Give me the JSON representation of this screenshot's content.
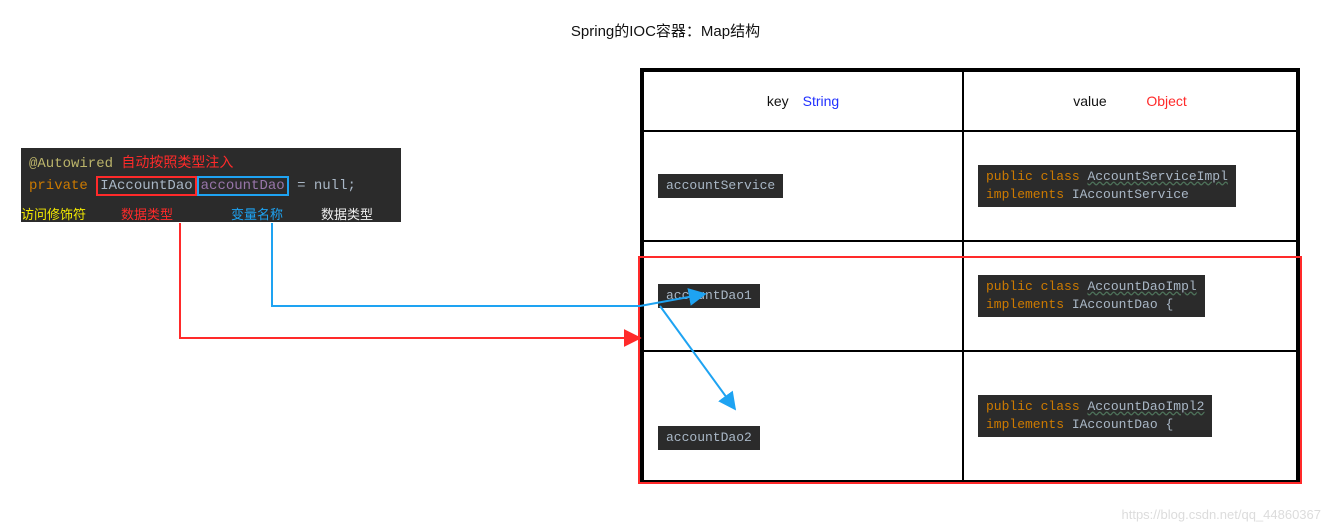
{
  "title": "Spring的IOC容器：Map结构",
  "code": {
    "annotation": "@Autowired",
    "annotation_note": "自动按照类型注入",
    "modifier": "private",
    "type": "IAccountDao",
    "varname": "accountDao",
    "tail": "= null;"
  },
  "labels": {
    "modifier": "访问修饰符",
    "datatype": "数据类型",
    "varname": "变量名称",
    "datatype2": "数据类型"
  },
  "table": {
    "head": {
      "key_label": "key",
      "key_type": "String",
      "value_label": "value",
      "value_type": "Object"
    },
    "rows": [
      {
        "key": "accountService",
        "value_line1": "public class AccountServiceImpl",
        "value_line2": "implements IAccountService"
      },
      {
        "key": "accountDao1",
        "value_line1": "public class AccountDaoImpl",
        "value_line2": "implements IAccountDao {"
      },
      {
        "key": "accountDao2",
        "value_line1": "public class AccountDaoImpl2",
        "value_line2": "implements IAccountDao {"
      }
    ]
  },
  "watermark": "https://blog.csdn.net/qq_44860367"
}
